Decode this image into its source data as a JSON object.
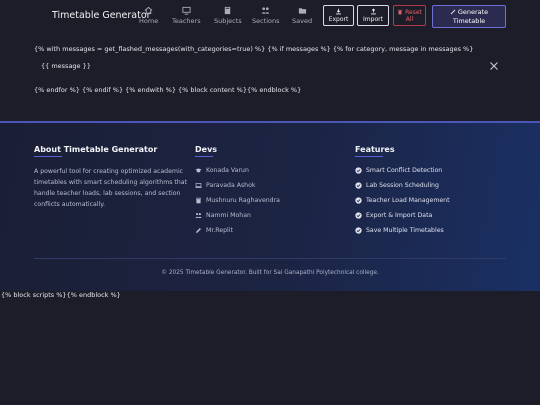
{
  "navbar": {
    "brand": "Timetable Generator",
    "items": [
      {
        "label": "Home",
        "icon": "home-icon"
      },
      {
        "label": "Teachers",
        "icon": "teachers-icon"
      },
      {
        "label": "Subjects",
        "icon": "book-icon"
      },
      {
        "label": "Sections",
        "icon": "users-icon"
      },
      {
        "label": "Saved",
        "icon": "folder-icon"
      }
    ],
    "export_label": "Export",
    "import_label": "Import",
    "reset_line1": "Reset",
    "reset_line2": "All",
    "generate_line1": "Generate",
    "generate_line2": "Timetable"
  },
  "template_text": {
    "line1": "{% with messages = get_flashed_messages(with_categories=true) %} {% if messages %} {% for category, message in messages %}",
    "message": "{{ message }}",
    "line3": "{% endfor %} {% endif %} {% endwith %} {% block content %}{% endblock %}",
    "scripts": "{% block scripts %}{% endblock %}"
  },
  "footer": {
    "about_title": "About Timetable Generator",
    "about_text": "A powerful tool for creating optimized academic timetables with smart scheduling algorithms that handle teacher loads, lab sessions, and section conflicts automatically.",
    "devs_title": "Devs",
    "devs": [
      {
        "name": "Konada Varun",
        "icon": "graduation-cap-icon"
      },
      {
        "name": "Paravada Ashok",
        "icon": "laptop-icon"
      },
      {
        "name": "Mushnuru Raghavendra",
        "icon": "book-icon"
      },
      {
        "name": "Nammi Mohan",
        "icon": "users-icon"
      },
      {
        "name": "Mr.Replit",
        "icon": "pencil-icon"
      }
    ],
    "features_title": "Features",
    "features": [
      "Smart Conflict Detection",
      "Lab Session Scheduling",
      "Teacher Load Management",
      "Export & Import Data",
      "Save Multiple Timetables"
    ],
    "copyright": "© 2025 Timetable Generator. Built for Sai Ganapathi Polytechnical college."
  },
  "colors": {
    "background": "#1c1d28",
    "accent": "#5a63d6",
    "reset": "#e3606a",
    "generate_bg": "#2a2b4f"
  }
}
